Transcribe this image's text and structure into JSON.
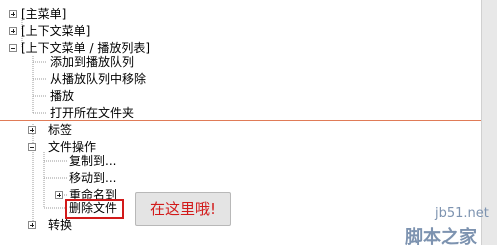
{
  "tree": {
    "items": [
      {
        "label": "[主菜单]"
      },
      {
        "label": "[上下文菜单]"
      },
      {
        "label": "[上下文菜单 / 播放列表]"
      },
      {
        "label": "添加到播放队列"
      },
      {
        "label": "从播放队列中移除"
      },
      {
        "label": "播放"
      },
      {
        "label": "打开所在文件夹"
      },
      {
        "label": "标签"
      },
      {
        "label": "文件操作"
      },
      {
        "label": "复制到..."
      },
      {
        "label": "移动到..."
      },
      {
        "label": "重命名到"
      },
      {
        "label": "删除文件"
      },
      {
        "label": "转换"
      }
    ]
  },
  "callout": {
    "text": "在这里哦!"
  },
  "watermark": {
    "site": "jb51.net",
    "brand": "脚本之家"
  },
  "colors": {
    "highlight": "#d21a1a",
    "callout_bg": "#e4e4e4"
  }
}
